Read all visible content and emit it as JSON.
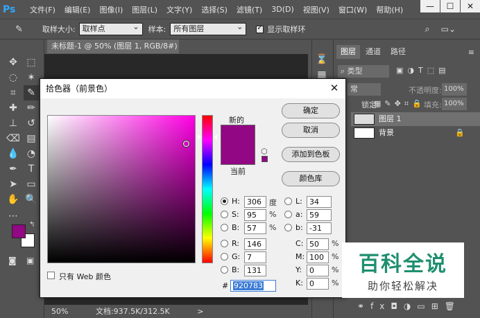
{
  "app": {
    "logo": "Ps"
  },
  "menu": [
    "文件(F)",
    "编辑(E)",
    "图像(I)",
    "图层(L)",
    "文字(Y)",
    "选择(S)",
    "滤镜(T)",
    "3D(D)",
    "视图(V)",
    "窗口(W)",
    "帮助(H)"
  ],
  "window_controls": {
    "minimize": "—",
    "maximize": "☐",
    "close": "✕"
  },
  "options_bar": {
    "sample_size_label": "取样大小:",
    "sample_size_value": "取样点",
    "sample_label": "样本:",
    "sample_value": "所有图层",
    "show_ring_label": "显示取样环",
    "show_ring_checked": true
  },
  "document": {
    "tab_title": "未标题-1 @ 50% (图层 1, RGB/8#) *",
    "tab_close": "×",
    "zoom": "50%",
    "doc_info": "文档:937.5K/312.5K",
    "arrow": ">"
  },
  "layers_panel": {
    "tabs": [
      "图层",
      "通道",
      "路径"
    ],
    "kind_filter": "类型",
    "blend_mode": "常",
    "opacity_label": "不透明度:",
    "opacity_value": "100%",
    "lock_label": "锁定:",
    "fill_label": "填充:",
    "fill_value": "100%",
    "layers": [
      {
        "name": "图层 1",
        "active": true
      },
      {
        "name": "背景",
        "active": false
      }
    ],
    "bottom_icons": [
      "link-icon",
      "fx-icon",
      "mask-icon",
      "adjustment-icon",
      "group-icon",
      "new-layer-icon",
      "trash-icon"
    ]
  },
  "color_picker": {
    "title": "拾色器（前景色）",
    "new_label": "新的",
    "current_label": "当前",
    "new_color": "#920783",
    "current_color": "#920783",
    "buttons": {
      "ok": "确定",
      "cancel": "取消",
      "add_swatch": "添加到色板",
      "libraries": "颜色库"
    },
    "web_only_label": "只有 Web 颜色",
    "hsb": {
      "H": {
        "label": "H:",
        "value": "306",
        "unit": "度"
      },
      "S": {
        "label": "S:",
        "value": "95",
        "unit": "%"
      },
      "B": {
        "label": "B:",
        "value": "57",
        "unit": "%"
      }
    },
    "rgb": {
      "R": {
        "label": "R:",
        "value": "146"
      },
      "G": {
        "label": "G:",
        "value": "7"
      },
      "B": {
        "label": "B:",
        "value": "131"
      }
    },
    "lab": {
      "L": {
        "label": "L:",
        "value": "34"
      },
      "a": {
        "label": "a:",
        "value": "59"
      },
      "b": {
        "label": "b:",
        "value": "-31"
      }
    },
    "cmyk": {
      "C": {
        "label": "C:",
        "value": "50",
        "unit": "%"
      },
      "M": {
        "label": "M:",
        "value": "100",
        "unit": "%"
      },
      "Y": {
        "label": "Y:",
        "value": "0",
        "unit": "%"
      },
      "K": {
        "label": "K:",
        "value": "0",
        "unit": "%"
      }
    },
    "hex_label": "#",
    "hex_value": "920783",
    "hue_level": 0.85
  },
  "watermark": {
    "title": "百科全说",
    "subtitle": "助你轻松解决"
  },
  "colors": {
    "foreground": "#920783",
    "background": "#ffffff",
    "ui_bg": "#535353"
  }
}
